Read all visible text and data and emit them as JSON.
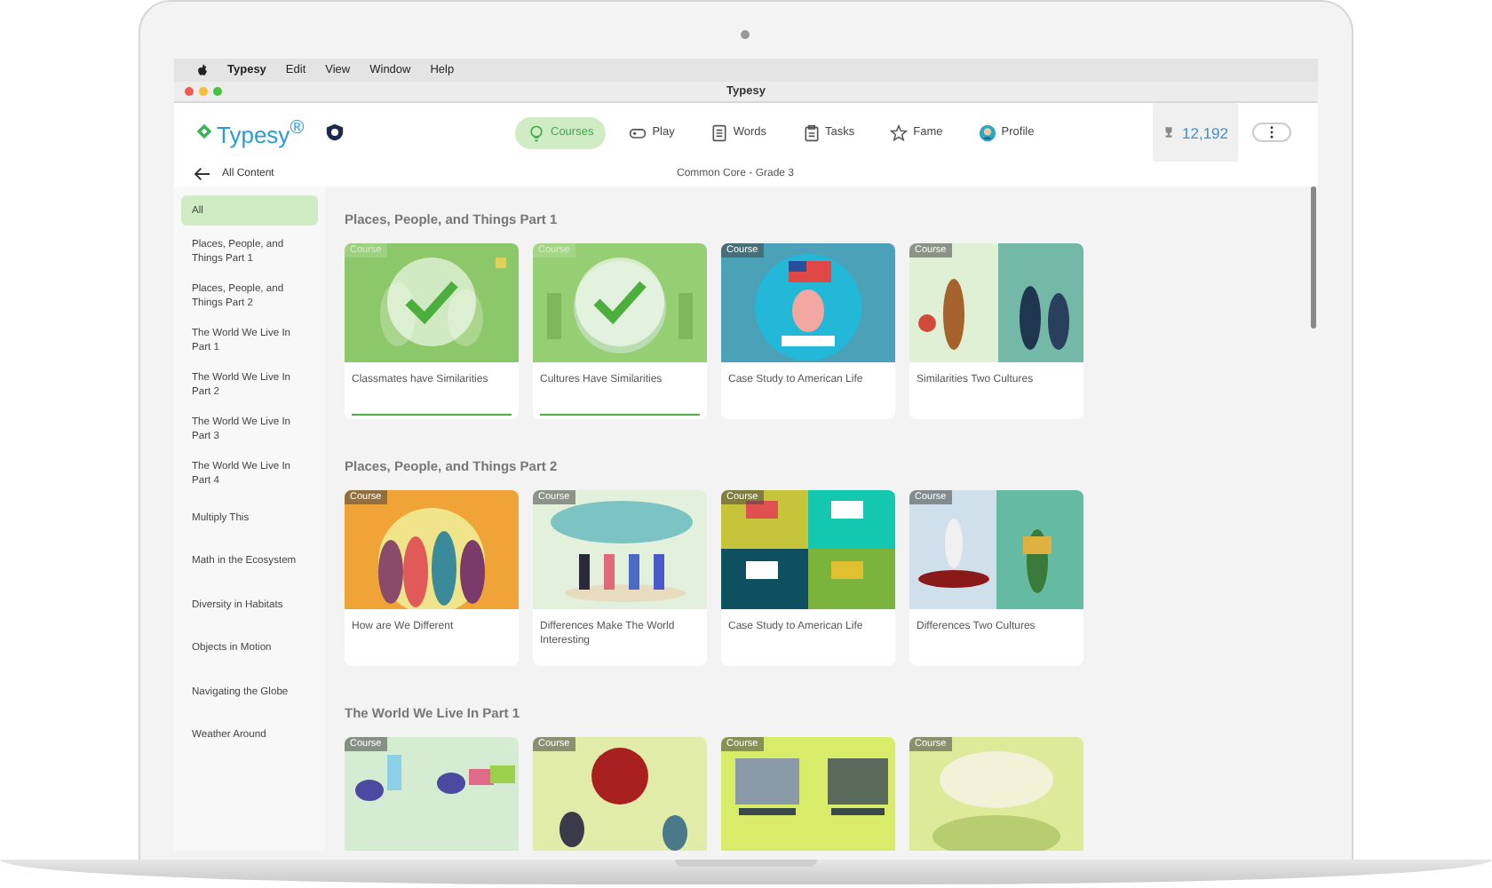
{
  "menubar": {
    "app_name": "Typesy",
    "items": [
      "Edit",
      "View",
      "Window",
      "Help"
    ]
  },
  "window": {
    "title": "Typesy"
  },
  "header": {
    "logo": "Typesy$^{®}$",
    "nav": [
      {
        "label": "Courses",
        "kind": "bulb",
        "selected": true
      },
      {
        "label": "Play",
        "kind": "gamepad",
        "selected": false
      },
      {
        "label": "Words",
        "kind": "list",
        "selected": false
      },
      {
        "label": "Tasks",
        "kind": "clipboard",
        "selected": false
      },
      {
        "label": "Fame",
        "kind": "star",
        "selected": false
      },
      {
        "label": "Profile",
        "kind": "avatar",
        "selected": false
      }
    ],
    "score": "12,192"
  },
  "subbar": {
    "back": "All Content",
    "title": "Common Core - Grade 3"
  },
  "sidebar": {
    "items": [
      {
        "label": "All",
        "selected": true
      },
      {
        "label": "Places, People, and Things Part 1",
        "selected": false
      },
      {
        "label": "Places, People, and Things Part 2",
        "selected": false
      },
      {
        "label": "The World We Live In Part 1",
        "selected": false
      },
      {
        "label": "The World We Live In Part 2",
        "selected": false
      },
      {
        "label": "The World We Live In Part 3",
        "selected": false
      },
      {
        "label": "The World We Live In Part 4",
        "selected": false
      },
      {
        "label": "Multiply This",
        "selected": false
      },
      {
        "label": "Math in the Ecosystem",
        "selected": false
      },
      {
        "label": "Diversity in Habitats",
        "selected": false
      },
      {
        "label": "Objects in Motion",
        "selected": false
      },
      {
        "label": "Navigating the Globe",
        "selected": false
      },
      {
        "label": "Weather Around",
        "selected": false
      }
    ]
  },
  "sections": [
    {
      "title": "Places, People, and Things Part 1",
      "cards": [
        {
          "badge": "Course",
          "title": "Classmates have Similarities",
          "completed": true,
          "level": 1
        },
        {
          "badge": "Course",
          "title": "Cultures Have Similarities",
          "completed": true,
          "level": 1
        },
        {
          "badge": "Course",
          "title": "Case Study to American Life",
          "completed": false
        },
        {
          "badge": "Course",
          "title": "Similarities Two Cultures",
          "completed": false
        }
      ]
    },
    {
      "title": "Places, People, and Things Part 2",
      "cards": [
        {
          "badge": "Course",
          "title": "How are We Different",
          "completed": false
        },
        {
          "badge": "Course",
          "title": "Differences Make The World Interesting",
          "completed": false
        },
        {
          "badge": "Course",
          "title": "Case Study to American Life",
          "completed": false
        },
        {
          "badge": "Course",
          "title": "Differences Two Cultures",
          "completed": false
        }
      ]
    },
    {
      "title": "The World We Live In Part 1",
      "cards": [
        {
          "badge": "Course",
          "completed": false
        },
        {
          "badge": "Course",
          "completed": false
        },
        {
          "badge": "Course",
          "completed": false
        },
        {
          "badge": "Course",
          "completed": false
        }
      ]
    }
  ]
}
